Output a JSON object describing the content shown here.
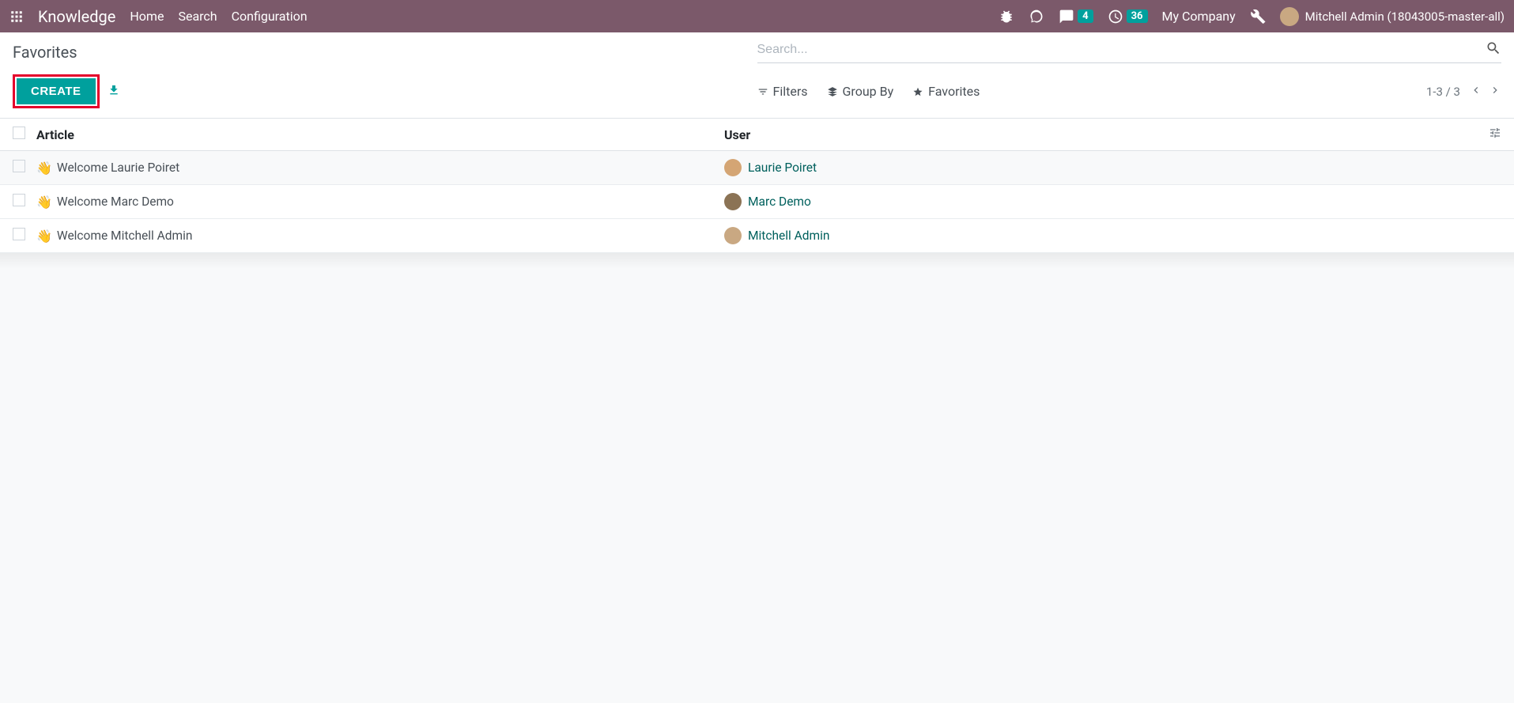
{
  "navbar": {
    "brand": "Knowledge",
    "links": [
      "Home",
      "Search",
      "Configuration"
    ],
    "messages_count": "4",
    "activities_count": "36",
    "company": "My Company",
    "user": "Mitchell Admin (18043005-master-all)"
  },
  "control_panel": {
    "breadcrumb": "Favorites",
    "search_placeholder": "Search...",
    "create_label": "CREATE",
    "filters_label": "Filters",
    "groupby_label": "Group By",
    "favorites_label": "Favorites",
    "pager": "1-3 / 3"
  },
  "table": {
    "header_article": "Article",
    "header_user": "User",
    "rows": [
      {
        "article": "Welcome Laurie Poiret",
        "user": "Laurie Poiret",
        "avatar_bg": "#d4a574"
      },
      {
        "article": "Welcome Marc Demo",
        "user": "Marc Demo",
        "avatar_bg": "#8b7355"
      },
      {
        "article": "Welcome Mitchell Admin",
        "user": "Mitchell Admin",
        "avatar_bg": "#c9a882"
      }
    ]
  }
}
